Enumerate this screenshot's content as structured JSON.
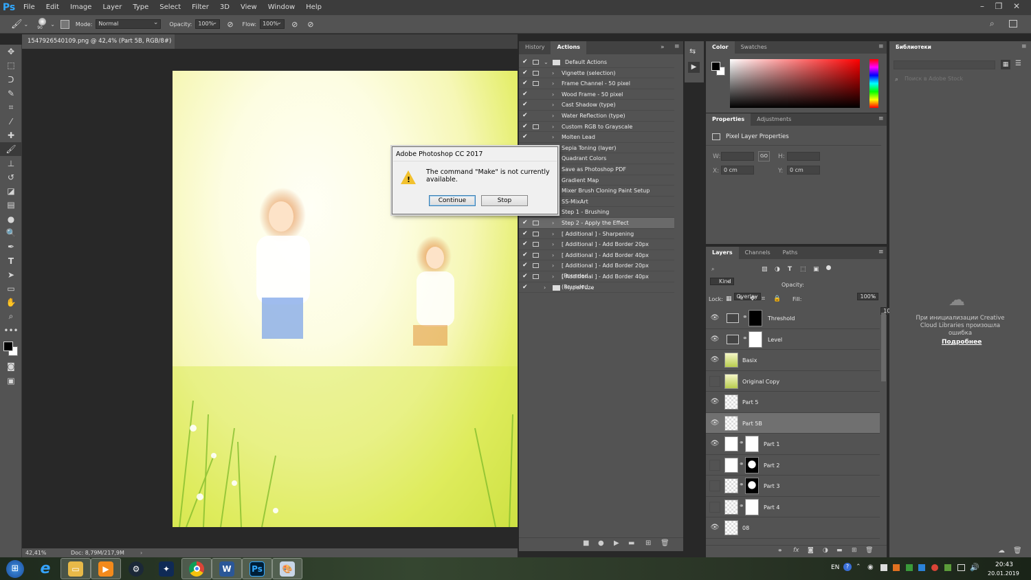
{
  "app": {
    "logo": "Ps"
  },
  "menu": [
    "File",
    "Edit",
    "Image",
    "Layer",
    "Type",
    "Select",
    "Filter",
    "3D",
    "View",
    "Window",
    "Help"
  ],
  "options": {
    "brush_size": "90",
    "mode_label": "Mode:",
    "mode_value": "Normal",
    "opacity_label": "Opacity:",
    "opacity_value": "100%",
    "flow_label": "Flow:",
    "flow_value": "100%"
  },
  "document": {
    "tab_title": "1547926540109.png @ 42,4% (Part 5B, RGB/8#) *",
    "close": "×",
    "zoom": "42,41%",
    "doc_info": "Doc: 8,79M/217,9M"
  },
  "actions_panel": {
    "tabs": [
      "History",
      "Actions"
    ],
    "items": [
      {
        "label": "Default Actions",
        "checked": true,
        "dialog": true,
        "expanded": true,
        "folder": true,
        "selected": false
      },
      {
        "label": "Vignette (selection)",
        "checked": true,
        "dialog": true
      },
      {
        "label": "Frame Channel - 50 pixel",
        "checked": true,
        "dialog": true
      },
      {
        "label": "Wood Frame - 50 pixel",
        "checked": true,
        "dialog": false
      },
      {
        "label": "Cast Shadow (type)",
        "checked": true,
        "dialog": false
      },
      {
        "label": "Water Reflection (type)",
        "checked": true,
        "dialog": false
      },
      {
        "label": "Custom RGB to Grayscale",
        "checked": true,
        "dialog": true
      },
      {
        "label": "Molten Lead",
        "checked": true,
        "dialog": false
      },
      {
        "label": "Sepia Toning (layer)",
        "checked": true,
        "dialog": false
      },
      {
        "label": "Quadrant Colors",
        "checked": true,
        "dialog": false
      },
      {
        "label": "Save as Photoshop PDF",
        "checked": true,
        "dialog": false
      },
      {
        "label": "Gradient Map",
        "checked": true,
        "dialog": false
      },
      {
        "label": "Mixer Brush Cloning Paint Setup",
        "checked": true,
        "dialog": false
      },
      {
        "label": "SS-MixArt",
        "checked": true,
        "dialog": false
      },
      {
        "label": "Step 1 - Brushing",
        "checked": true,
        "dialog": false
      },
      {
        "label": "Step 2 - Apply the Effect",
        "checked": true,
        "dialog": true,
        "selected": true
      },
      {
        "label": "[ Additional ] - Sharpening",
        "checked": true,
        "dialog": true
      },
      {
        "label": "[ Additional ] - Add Border 20px",
        "checked": true,
        "dialog": true
      },
      {
        "label": "[ Additional ] - Add Border 40px",
        "checked": true,
        "dialog": true
      },
      {
        "label": "[ Additional ] - Add Border 20px (Rounded...",
        "checked": true,
        "dialog": true
      },
      {
        "label": "[ Additional ] - Add Border 40px (Rounded...",
        "checked": true,
        "dialog": true
      },
      {
        "label": "HyperFuze",
        "checked": true,
        "dialog": false,
        "folder": true
      }
    ]
  },
  "dialog": {
    "title": "Adobe Photoshop CC 2017",
    "message": "The command \"Make\" is not currently available.",
    "continue": "Continue",
    "stop": "Stop"
  },
  "color_panel": {
    "tabs": [
      "Color",
      "Swatches"
    ]
  },
  "properties_panel": {
    "tabs": [
      "Properties",
      "Adjustments"
    ],
    "title": "Pixel Layer Properties",
    "w_label": "W:",
    "h_label": "H:",
    "x_label": "X:",
    "x_value": "0 cm",
    "y_label": "Y:",
    "y_value": "0 cm",
    "link": "GO"
  },
  "layers_panel": {
    "tabs": [
      "Layers",
      "Channels",
      "Paths"
    ],
    "kind": "Kind",
    "blend": "Overlay",
    "opacity_label": "Opacity:",
    "opacity": "100%",
    "lock_label": "Lock:",
    "fill_label": "Fill:",
    "fill": "100%",
    "layers": [
      {
        "name": "Threshold",
        "visible": true,
        "type": "adjustment",
        "mask": "black"
      },
      {
        "name": "Level",
        "visible": true,
        "type": "levels",
        "mask": "white"
      },
      {
        "name": "Basix",
        "visible": true,
        "type": "photo"
      },
      {
        "name": "Original Copy",
        "visible": false,
        "type": "photo"
      },
      {
        "name": "Part 5",
        "visible": true,
        "type": "transparent"
      },
      {
        "name": "Part 5B",
        "visible": true,
        "type": "transparent",
        "selected": true
      },
      {
        "name": "Part 1",
        "visible": true,
        "type": "white",
        "mask": "white"
      },
      {
        "name": "Part 2",
        "visible": false,
        "type": "white",
        "mask": "shape"
      },
      {
        "name": "Part 3",
        "visible": false,
        "type": "transparent",
        "mask": "shape"
      },
      {
        "name": "Part 4",
        "visible": false,
        "type": "transparent",
        "mask": "white"
      },
      {
        "name": "08",
        "visible": true,
        "type": "transparent"
      }
    ]
  },
  "libraries_panel": {
    "title": "Библиотеки",
    "search_placeholder": "Поиск в Adobe Stock",
    "error": "При инициализации Creative Cloud Libraries произошла ошибка",
    "more": "Подробнее"
  },
  "taskbar": {
    "lang": "EN",
    "time": "20:43",
    "date": "20.01.2019"
  }
}
